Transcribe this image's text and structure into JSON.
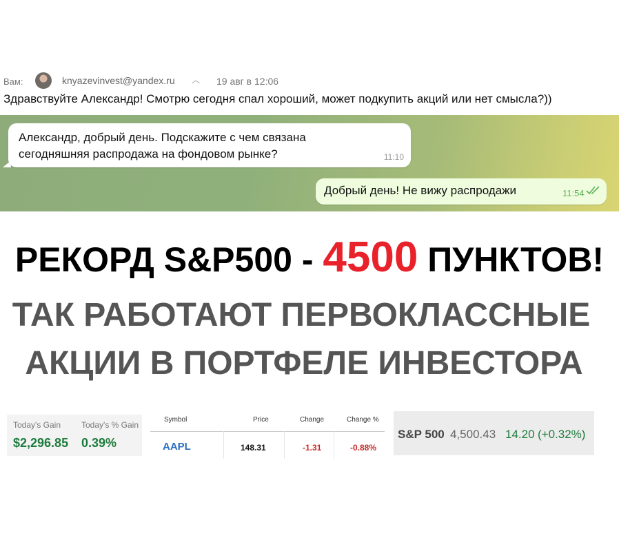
{
  "email": {
    "to_label": "Вам:",
    "sender": "knyazevinvest@yandex.ru",
    "date": "19 авг в 12:06",
    "body": "Здравствуйте Александр! Смотрю сегодня спал хороший, может подкупить акций или нет смысла?))"
  },
  "chat": {
    "incoming": {
      "text": "Александр, добрый день. Подскажите с чем связана сегодняшняя распродажа на фондовом рынке?",
      "time": "11:10"
    },
    "outgoing": {
      "text": "Добрый день! Не вижу распродажи",
      "time": "11:54"
    }
  },
  "headline": {
    "line1_prefix": "РЕКОРД S&P500 - ",
    "line1_number": "4500",
    "line1_suffix": " ПУНКТОВ!",
    "line2": "ТАК РАБОТАЮТ ПЕРВОКЛАССНЫЕ",
    "line3": "АКЦИИ В ПОРТФЕЛЕ ИНВЕСТОРА"
  },
  "gain": {
    "gain_label": "Today's Gain",
    "gain_value": "$2,296.85",
    "pct_label": "Today's % Gain",
    "pct_value": "0.39%"
  },
  "quote": {
    "headers": {
      "symbol": "Symbol",
      "price": "Price",
      "change": "Change",
      "change_pct": "Change %"
    },
    "row": {
      "symbol": "AAPL",
      "price": "148.31",
      "change": "-1.31",
      "change_pct": "-0.88%"
    }
  },
  "index": {
    "name": "S&P 500",
    "value": "4,500.43",
    "change": "14.20",
    "change_pct": "(+0.32%)"
  },
  "colors": {
    "accent_red": "#e8212b",
    "gain_green": "#1e7b3c",
    "loss_red": "#c62828",
    "symbol_blue": "#2a6ebf"
  }
}
